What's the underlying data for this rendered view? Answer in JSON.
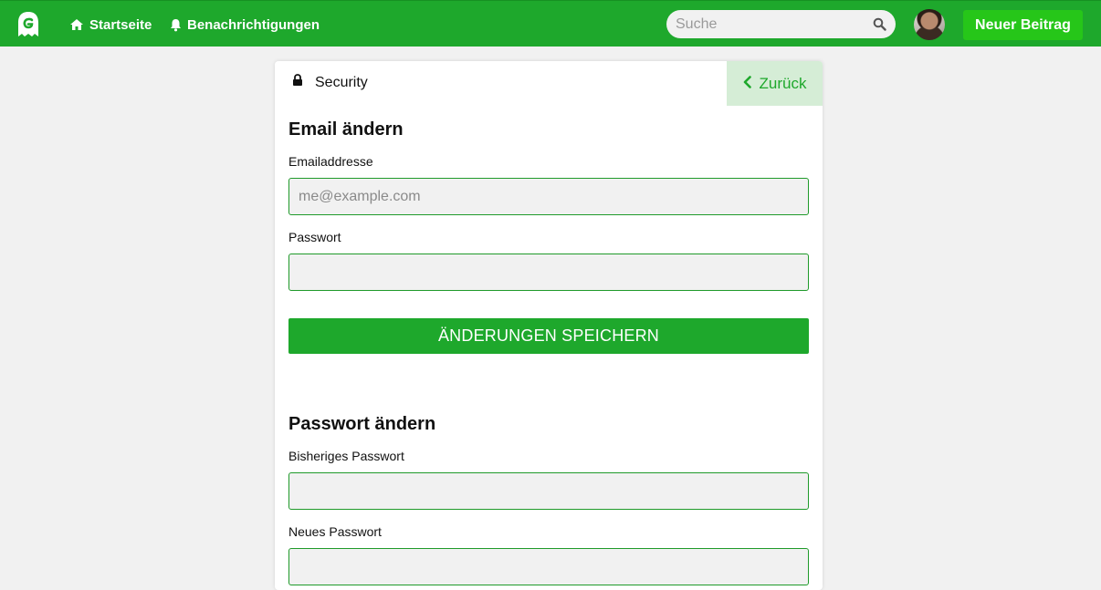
{
  "nav": {
    "logo_icon": "ghost-logo-icon",
    "home_label": "Startseite",
    "notifications_label": "Benachrichtigungen",
    "search_placeholder": "Suche",
    "new_post_label": "Neuer Beitrag"
  },
  "card": {
    "section_title": "Security",
    "back_label": "Zurück",
    "email_section": {
      "heading": "Email ändern",
      "email_label": "Emailaddresse",
      "email_placeholder": "me@example.com",
      "email_value": "",
      "password_label": "Passwort",
      "password_value": "",
      "save_label": "ÄNDERUNGEN SPEICHERN"
    },
    "password_section": {
      "heading": "Passwort ändern",
      "current_label": "Bisheriges Passwort",
      "current_value": "",
      "new_label": "Neues Passwort",
      "new_value": ""
    }
  },
  "colors": {
    "brand": "#1ea82c",
    "new_post": "#26c619",
    "back_bg": "#d5edd6"
  }
}
